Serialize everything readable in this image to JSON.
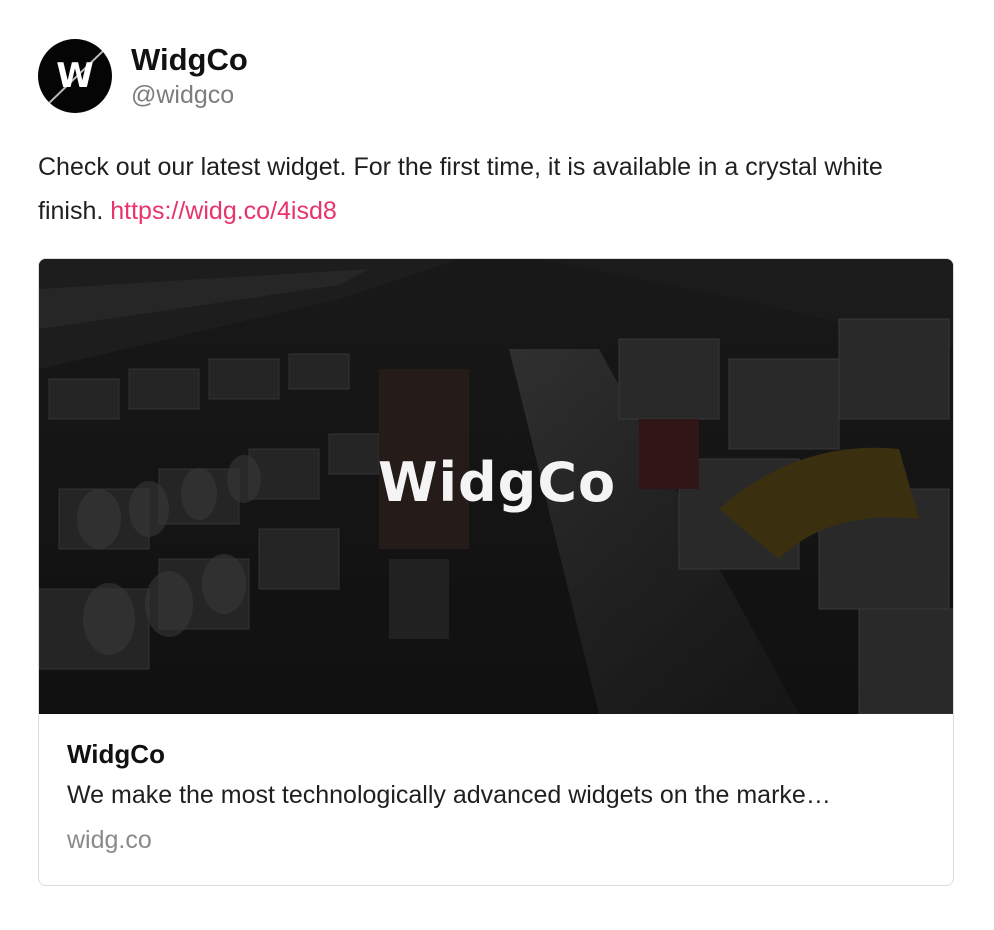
{
  "author": {
    "display_name": "WidgCo",
    "handle": "@widgco",
    "avatar_letter": "W"
  },
  "post": {
    "text": "Check out our latest widget. For the first time, it is available in a crystal white finish.",
    "link": "https://widg.co/4isd8",
    "link_color": "#e8336b"
  },
  "card": {
    "image_logo_text": "WidgCo",
    "title": "WidgCo",
    "description": "We make the most technologically advanced widgets on the marke…",
    "domain": "widg.co"
  }
}
